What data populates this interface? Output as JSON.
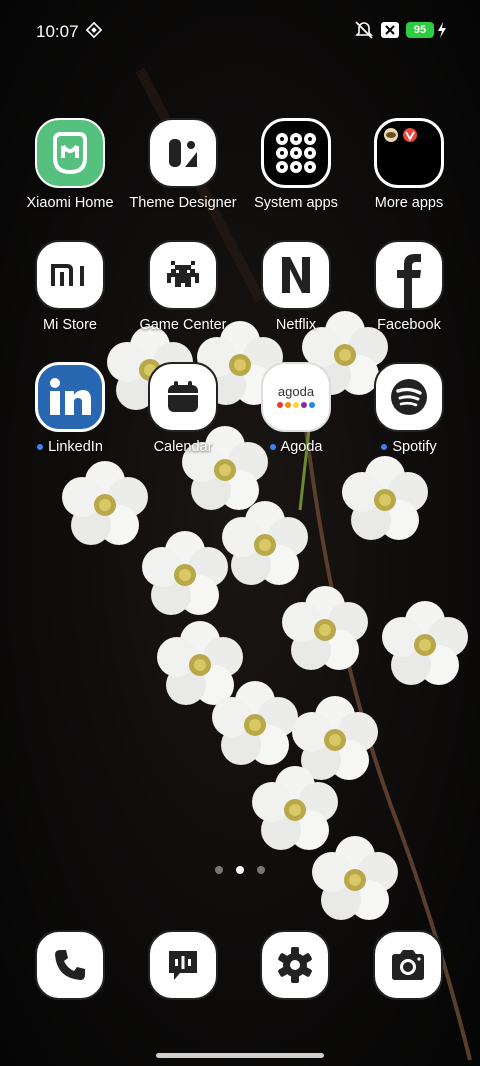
{
  "status_bar": {
    "time": "10:07",
    "battery_level": "95",
    "icons": [
      "diamond-icon",
      "mute-icon",
      "no-sim-icon",
      "charging-icon"
    ]
  },
  "apps": [
    {
      "label": "Xiaomi Home",
      "icon": "xiaomi-home-icon"
    },
    {
      "label": "Theme Designer",
      "icon": "theme-designer-icon"
    },
    {
      "label": "System apps",
      "icon": "system-apps-folder-icon"
    },
    {
      "label": "More apps",
      "icon": "more-apps-folder-icon"
    },
    {
      "label": "Mi Store",
      "icon": "mi-store-icon"
    },
    {
      "label": "Game Center",
      "icon": "game-center-icon"
    },
    {
      "label": "Netflix",
      "icon": "netflix-icon"
    },
    {
      "label": "Facebook",
      "icon": "facebook-icon"
    },
    {
      "label": "LinkedIn",
      "icon": "linkedin-icon",
      "new": true
    },
    {
      "label": "Calendar",
      "icon": "calendar-icon"
    },
    {
      "label": "Agoda",
      "icon": "agoda-icon",
      "new": true
    },
    {
      "label": "Spotify",
      "icon": "spotify-icon",
      "new": true
    }
  ],
  "agoda_logo_text": "agoda",
  "page_indicator": {
    "total": 3,
    "active": 2
  },
  "dock": [
    "phone-icon",
    "messages-icon",
    "settings-icon",
    "camera-icon"
  ],
  "colors": {
    "new_dot": "#3b82f6",
    "battery": "#2ecc40",
    "xiaomi_home": "#56c17e",
    "linkedin": "#2867b2"
  }
}
